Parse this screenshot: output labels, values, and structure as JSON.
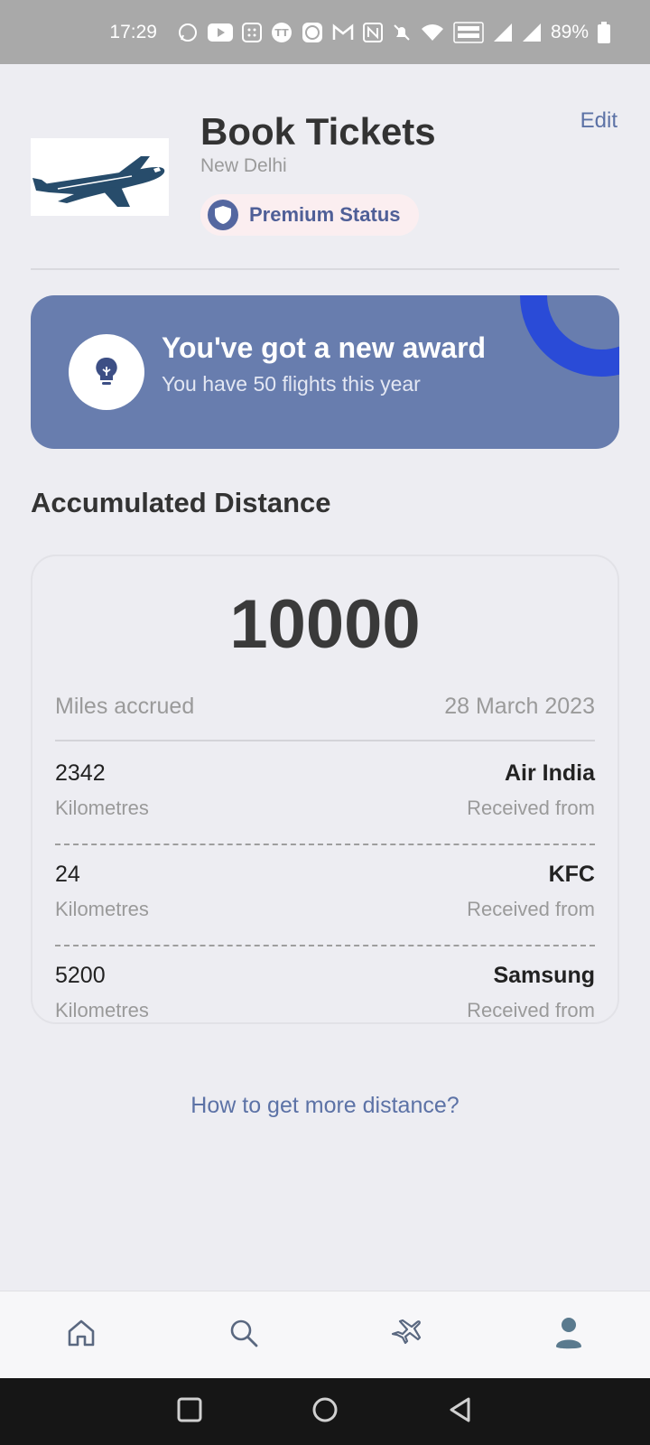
{
  "status_bar": {
    "time": "17:29",
    "battery": "89%",
    "icons": [
      "whatsapp-icon",
      "youtube-icon",
      "grid-app-icon",
      "tt-app-icon",
      "cb-app-icon",
      "gmail-icon",
      "nfc-icon",
      "mute-icon",
      "wifi-icon",
      "vowifi-icon",
      "signal-icon",
      "signal-icon",
      "battery-icon"
    ]
  },
  "header": {
    "title": "Book Tickets",
    "location": "New Delhi",
    "edit_label": "Edit",
    "badge_label": "Premium Status",
    "logo_icon": "airplane-logo"
  },
  "award": {
    "title": "You've got a new award",
    "subtitle": "You have 50 flights this year",
    "icon": "lightbulb-icon",
    "color": "#687dae",
    "accent": "#2a4bd7"
  },
  "distance": {
    "section_title": "Accumulated Distance",
    "total": "10000",
    "total_label": "Miles accrued",
    "date": "28 March 2023",
    "entries": [
      {
        "amount": "2342",
        "unit": "Kilometres",
        "source": "Air India",
        "received_label": "Received from"
      },
      {
        "amount": "24",
        "unit": "Kilometres",
        "source": "KFC",
        "received_label": "Received from"
      },
      {
        "amount": "5200",
        "unit": "Kilometres",
        "source": "Samsung",
        "received_label": "Received from"
      }
    ]
  },
  "more_link": "How to get more distance?",
  "bottom_nav": {
    "items": [
      "home-icon",
      "search-icon",
      "airplane-icon",
      "profile-icon"
    ]
  },
  "system_nav": [
    "recents-button",
    "home-button",
    "back-button"
  ]
}
